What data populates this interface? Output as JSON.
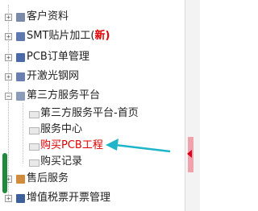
{
  "sidebar": {
    "items": [
      {
        "label": "客户资料",
        "icon": "user-icon",
        "color": "#7a8aa8"
      },
      {
        "label": "SMT贴片加工(",
        "tag": "新)",
        "icon": "chip-icon",
        "color": "#5f79b0"
      },
      {
        "label": "PCB订单管理",
        "icon": "chip-icon",
        "color": "#4d6aa8"
      },
      {
        "label": "开激光钢网",
        "icon": "chip-icon",
        "color": "#6b7fb0"
      },
      {
        "label": "第三方服务平台",
        "icon": "folder-icon",
        "color": "#8a9cb8",
        "expanded": true,
        "children": [
          {
            "label": "第三方服务平台-首页"
          },
          {
            "label": "服务中心"
          },
          {
            "label": "购买PCB工程",
            "highlight": true
          },
          {
            "label": "购买记录"
          }
        ]
      },
      {
        "label": "售后服务",
        "icon": "person-icon",
        "color": "#d28a3c"
      },
      {
        "label": "增值税票开票管理",
        "icon": "card-icon",
        "color": "#3d5f9a"
      }
    ]
  },
  "colors": {
    "highlight": "#e00000",
    "annotation_arrow": "#1fb5c8",
    "collapse_tab": "#f0a3ad",
    "collapse_arrow": "#d6001c",
    "scroll_handle": "#1f8a3c"
  }
}
